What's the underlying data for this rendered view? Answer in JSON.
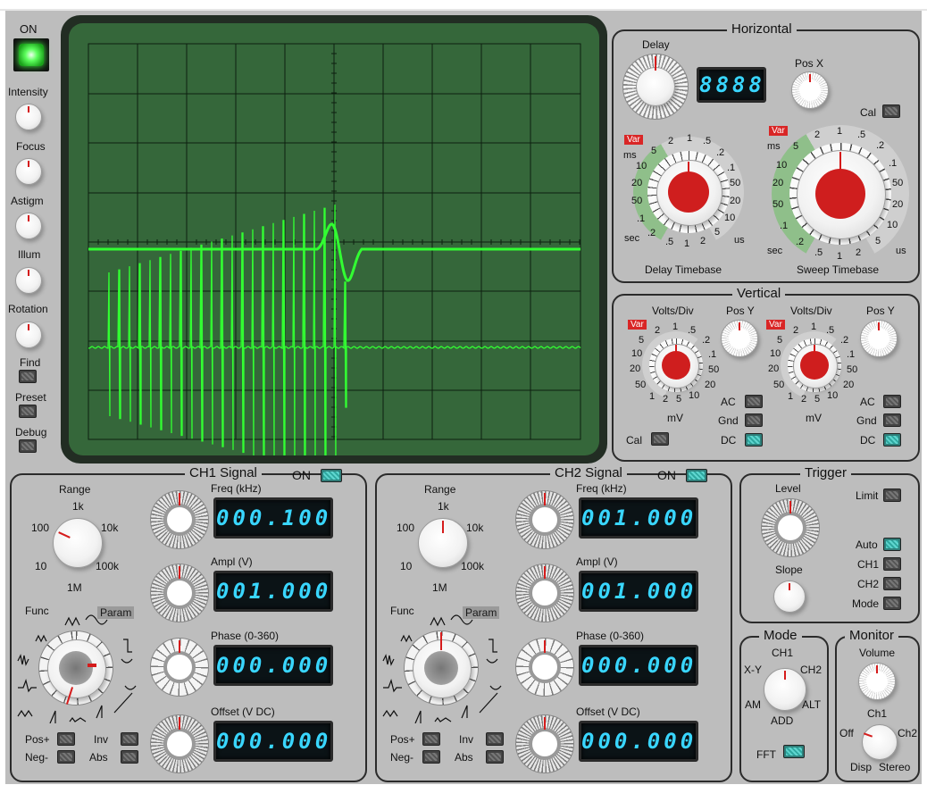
{
  "power": {
    "label": "ON"
  },
  "left_controls": [
    {
      "label": "Intensity"
    },
    {
      "label": "Focus"
    },
    {
      "label": "Astigm"
    },
    {
      "label": "Illum"
    },
    {
      "label": "Rotation"
    }
  ],
  "left_switches": [
    {
      "label": "Find"
    },
    {
      "label": "Preset"
    },
    {
      "label": "Debug"
    }
  ],
  "horizontal": {
    "title": "Horizontal",
    "delay_label": "Delay",
    "delay_display": "8888",
    "posx_label": "Pos X",
    "cal_label": "Cal",
    "var_label": "Var",
    "delay_tb": {
      "label": "Delay Timebase",
      "units": [
        "ms",
        "sec",
        "us"
      ],
      "scale_top": [
        "5",
        "2",
        "1",
        ".5",
        ".2",
        ".1"
      ],
      "scale_left": [
        "10",
        "20",
        "50",
        ".1",
        ".2"
      ],
      "scale_right": [
        "50",
        "20",
        "10",
        "5",
        "2",
        "1"
      ],
      "scale_bottom": [
        ".5"
      ]
    },
    "sweep_tb": {
      "label": "Sweep Timebase",
      "units": [
        "ms",
        "sec",
        "us"
      ],
      "scale_top": [
        "5",
        "2",
        "1",
        ".5",
        ".2",
        ".1"
      ],
      "scale_left": [
        "10",
        "20",
        "50",
        ".1",
        ".2"
      ],
      "scale_right": [
        "50",
        "20",
        "10",
        "5",
        "2",
        "1"
      ],
      "scale_bottom": [
        ".5"
      ]
    }
  },
  "vertical": {
    "title": "Vertical",
    "volts_label": "Volts/Div",
    "posy_label": "Pos Y",
    "unit": "mV",
    "var_label": "Var",
    "scale_top": [
      "2",
      "1",
      ".5"
    ],
    "scale_left": [
      "5",
      "10",
      "20",
      "50"
    ],
    "scale_right": [
      ".2",
      ".1",
      "50",
      "20"
    ],
    "scale_bottom": [
      "1",
      "2",
      "5",
      "10"
    ],
    "coupling": [
      "AC",
      "Gnd",
      "DC"
    ],
    "cal_label": "Cal"
  },
  "ch1": {
    "title": "CH1 Signal",
    "on_label": "ON",
    "range_label": "Range",
    "range_marks": [
      "1k",
      "100",
      "10k",
      "10",
      "100k",
      "1M"
    ],
    "freq_label": "Freq (kHz)",
    "freq": "000.100",
    "ampl_label": "Ampl (V)",
    "ampl": "001.000",
    "phase_label": "Phase (0-360)",
    "phase": "000.000",
    "offset_label": "Offset (V DC)",
    "offset": "000.000",
    "func_label": "Func",
    "param_label": "Param",
    "pos_label": "Pos+",
    "neg_label": "Neg-",
    "inv_label": "Inv",
    "abs_label": "Abs"
  },
  "ch2": {
    "title": "CH2 Signal",
    "on_label": "ON",
    "range_label": "Range",
    "range_marks": [
      "1k",
      "100",
      "10k",
      "10",
      "100k",
      "1M"
    ],
    "freq_label": "Freq (kHz)",
    "freq": "001.000",
    "ampl_label": "Ampl (V)",
    "ampl": "001.000",
    "phase_label": "Phase (0-360)",
    "phase": "000.000",
    "offset_label": "Offset (V DC)",
    "offset": "000.000",
    "func_label": "Func",
    "param_label": "Param",
    "pos_label": "Pos+",
    "neg_label": "Neg-",
    "inv_label": "Inv",
    "abs_label": "Abs"
  },
  "trigger": {
    "title": "Trigger",
    "level_label": "Level",
    "slope_label": "Slope",
    "limit_label": "Limit",
    "modes": [
      "Auto",
      "CH1",
      "CH2",
      "Mode"
    ]
  },
  "mode": {
    "title": "Mode",
    "positions": [
      "CH1",
      "X-Y",
      "CH2",
      "AM",
      "ALT",
      "ADD"
    ],
    "fft_label": "FFT"
  },
  "monitor": {
    "title": "Monitor",
    "volume_label": "Volume",
    "ch_label": "Ch1",
    "positions": [
      "Off",
      "Ch2",
      "Disp",
      "Stereo"
    ]
  },
  "colors": {
    "trace": "#32ff32",
    "screen": "#35673a",
    "lcd": "#39d6ff",
    "indicator": "#d51b1b",
    "switch_on": "#2fa8a0"
  }
}
